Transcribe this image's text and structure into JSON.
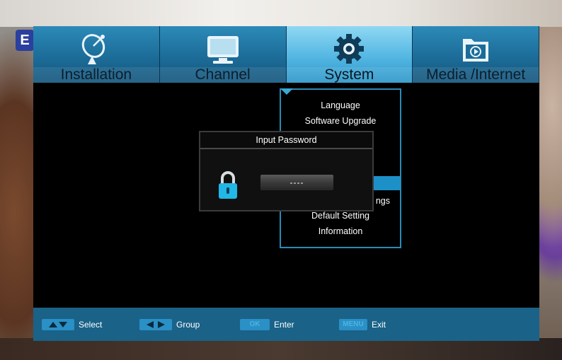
{
  "tabs": [
    {
      "label": "Installation",
      "icon": "satellite-dish-icon",
      "active": false
    },
    {
      "label": "Channel",
      "icon": "tv-monitor-icon",
      "active": false
    },
    {
      "label": "System",
      "icon": "gear-icon",
      "active": true
    },
    {
      "label": "Media /Internet",
      "icon": "media-folder-icon",
      "active": false
    }
  ],
  "submenu": {
    "items": [
      "Language",
      "Software Upgrade",
      "ngs",
      "Default Setting",
      "Information"
    ]
  },
  "dialog": {
    "title": "Input Password",
    "password_value": "----"
  },
  "helpbar": {
    "select_key": "▲▼",
    "select_label": "Select",
    "group_key": "◀▶",
    "group_label": "Group",
    "ok_key": "OK",
    "ok_label": "Enter",
    "menu_key": "MENU",
    "menu_label": "Exit"
  },
  "badge_letter": "E",
  "colors": {
    "tab_blue": "#1c6c98",
    "tab_active": "#53b6e2",
    "help_bar": "#1a6288",
    "highlight": "#1e90c8",
    "lock_cyan": "#22b7e6"
  }
}
